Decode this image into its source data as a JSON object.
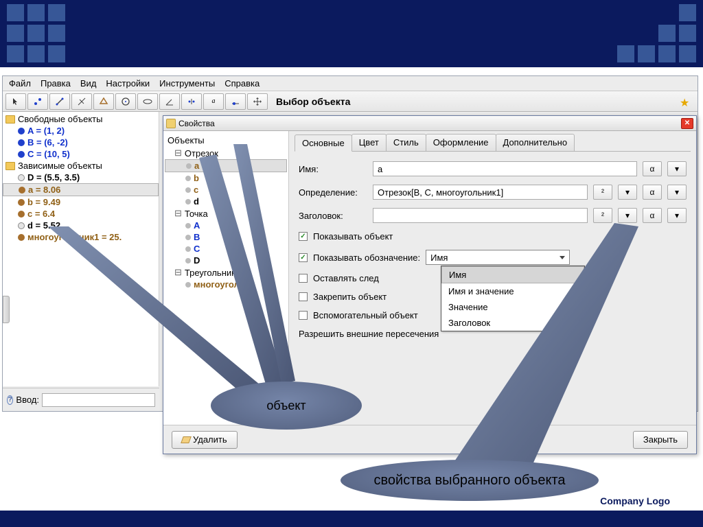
{
  "menubar": [
    "Файл",
    "Правка",
    "Вид",
    "Настройки",
    "Инструменты",
    "Справка"
  ],
  "toolbar_title": "Выбор объекта",
  "algebra": {
    "free_header": "Свободные объекты",
    "free": [
      {
        "label": "A = (1, 2)",
        "cls": "blue"
      },
      {
        "label": "B = (6, -2)",
        "cls": "blue"
      },
      {
        "label": "C = (10, 5)",
        "cls": "blue"
      }
    ],
    "dep_header": "Зависимые объекты",
    "dep": [
      {
        "label": "D = (5.5, 3.5)",
        "cls": "black"
      },
      {
        "label": "a = 8.06",
        "cls": "brown",
        "sel": true
      },
      {
        "label": "b = 9.49",
        "cls": "brown"
      },
      {
        "label": "c = 6.4",
        "cls": "brown"
      },
      {
        "label": "d = 5.52",
        "cls": "black"
      },
      {
        "label": "многоугольник1 = 25.",
        "cls": "brown"
      }
    ]
  },
  "input_label": "Ввод:",
  "dialog": {
    "title": "Свойства",
    "tree_header": "Объекты",
    "groups": [
      {
        "name": "Отрезок",
        "children": [
          {
            "label": "a",
            "cls": "brown",
            "sel": true
          },
          {
            "label": "b",
            "cls": "brown"
          },
          {
            "label": "c",
            "cls": "brown"
          },
          {
            "label": "d",
            "cls": "black"
          }
        ]
      },
      {
        "name": "Точка",
        "children": [
          {
            "label": "A",
            "cls": "blue"
          },
          {
            "label": "B",
            "cls": "blue"
          },
          {
            "label": "C",
            "cls": "blue"
          },
          {
            "label": "D",
            "cls": "black"
          }
        ]
      },
      {
        "name": "Треугольник",
        "children": [
          {
            "label": "многоугольн",
            "cls": "brown"
          }
        ]
      }
    ],
    "tabs": [
      "Основные",
      "Цвет",
      "Стиль",
      "Оформление",
      "Дополнительно"
    ],
    "active_tab": 0,
    "form": {
      "name_label": "Имя:",
      "name_value": "a",
      "def_label": "Определение:",
      "def_value": "Отрезок[B, C, многоугольник1]",
      "caption_label": "Заголовок:",
      "caption_value": "",
      "show_obj": "Показывать объект",
      "show_label": "Показывать обозначение:",
      "label_select": "Имя",
      "label_options": [
        "Имя",
        "Имя и значение",
        "Значение",
        "Заголовок"
      ],
      "trace": "Оставлять след",
      "fix": "Закрепить объект",
      "aux": "Вспомогательный объект",
      "allow_outlying": "Разрешить внешние пересечения",
      "alpha": "α",
      "sq": "²"
    },
    "delete_btn": "Удалить",
    "close_btn": "Закрыть"
  },
  "callout1": "объект",
  "callout2": "свойства выбранного объекта",
  "company": "Company  Logo"
}
